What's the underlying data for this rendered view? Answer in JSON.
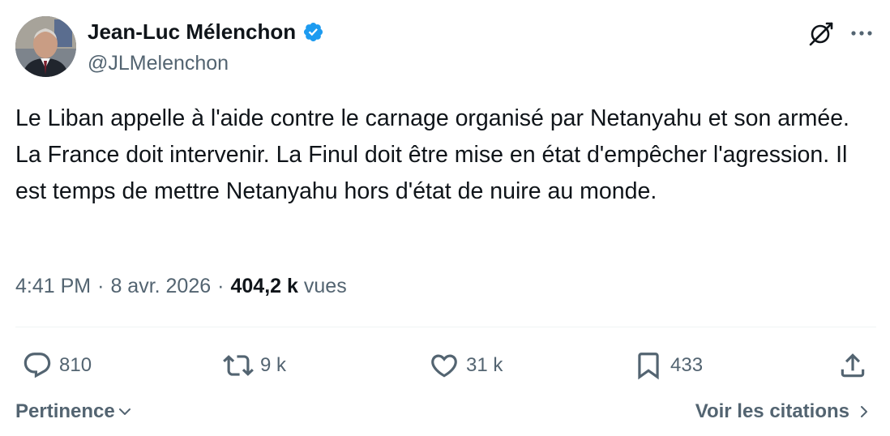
{
  "author": {
    "display_name": "Jean-Luc Mélenchon",
    "handle": "@JLMelenchon",
    "verified_color": "#1d9bf0"
  },
  "tweet": {
    "text": "Le Liban appelle à l'aide contre le carnage organisé par Netanyahu et son armée. La France doit intervenir. La Finul doit être mise en état d'empêcher l'agression. Il est temps de mettre Netanyahu hors d'état de nuire au monde."
  },
  "meta": {
    "time": "4:41 PM",
    "date": "8 avr. 2026",
    "separator": "·",
    "views_count": "404,2 k",
    "views_label": "vues"
  },
  "actions": {
    "replies": "810",
    "reposts": "9 k",
    "likes": "31 k",
    "bookmarks": "433"
  },
  "footer": {
    "sort_label": "Pertinence",
    "quotes_label": "Voir les citations"
  },
  "icons": {
    "grok": "grok-icon",
    "more": "more-icon",
    "reply": "reply-icon",
    "retweet": "retweet-icon",
    "like": "heart-icon",
    "bookmark": "bookmark-icon",
    "share": "share-icon"
  },
  "colors": {
    "text_primary": "#0f1419",
    "text_secondary": "#536471",
    "divider": "#eff3f4"
  }
}
